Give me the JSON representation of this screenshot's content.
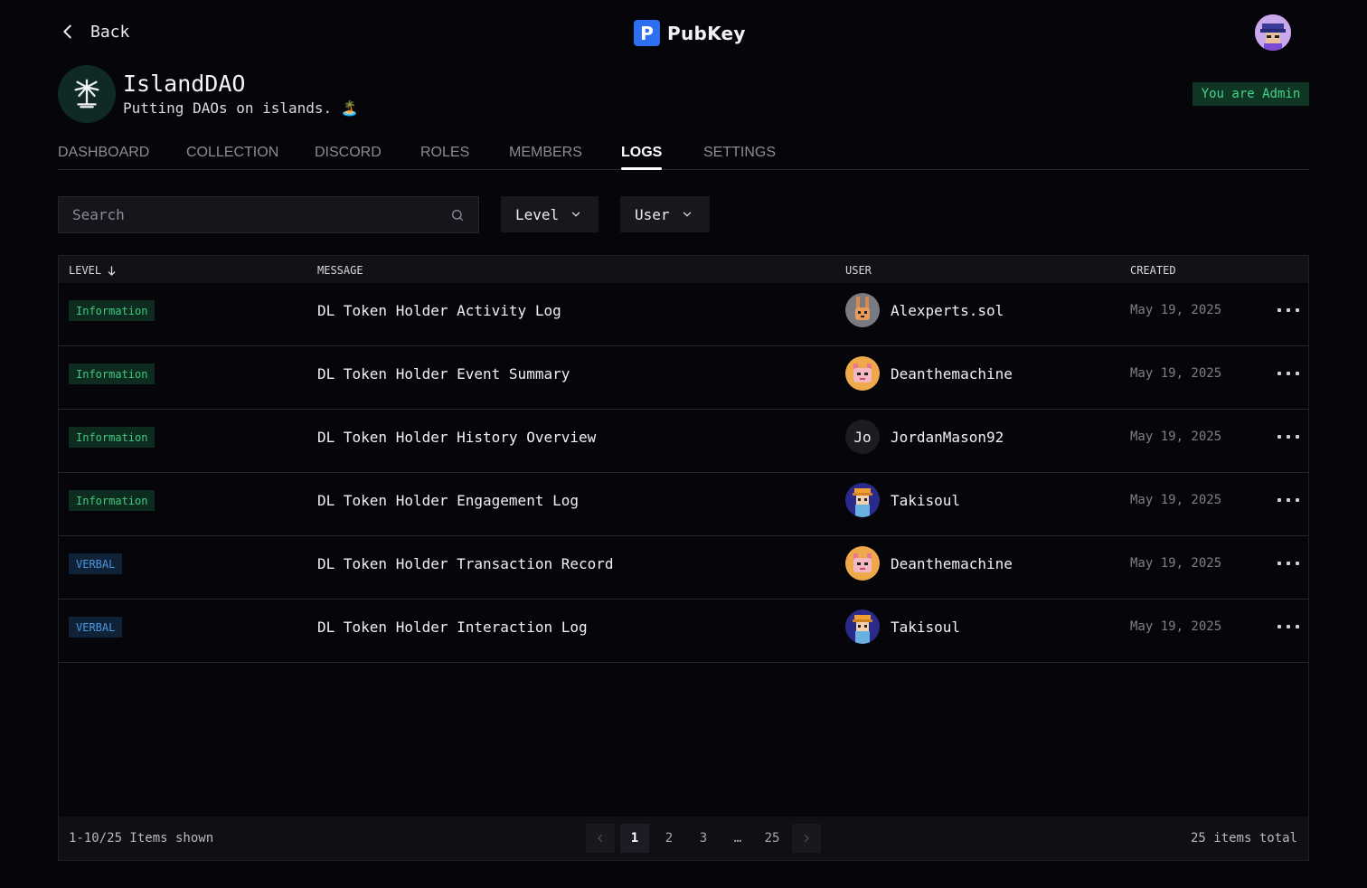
{
  "header": {
    "back_label": "Back",
    "brand_letter": "P",
    "brand_name": "PubKey"
  },
  "dao": {
    "name": "IslandDAO",
    "tagline": "Putting DAOs on islands. 🏝️",
    "admin_badge": "You are Admin"
  },
  "tabs": [
    {
      "label": "DASHBOARD"
    },
    {
      "label": "COLLECTION"
    },
    {
      "label": "DISCORD"
    },
    {
      "label": "ROLES"
    },
    {
      "label": "MEMBERS"
    },
    {
      "label": "LOGS"
    },
    {
      "label": "SETTINGS"
    }
  ],
  "active_tab": "LOGS",
  "filters": {
    "search_placeholder": "Search",
    "level_label": "Level",
    "user_label": "User"
  },
  "table": {
    "headers": {
      "level": "LEVEL",
      "message": "MESSAGE",
      "user": "USER",
      "created": "CREATED"
    },
    "rows": [
      {
        "level": "Information",
        "message": "DL Token Holder Activity Log",
        "user": "Alexperts.sol",
        "avatar": "rabbit-avatar",
        "created": "May 19, 2025"
      },
      {
        "level": "Information",
        "message": "DL Token Holder Event Summary",
        "user": "Deanthemachine",
        "avatar": "fox-avatar",
        "created": "May 19, 2025"
      },
      {
        "level": "Information",
        "message": "DL Token Holder History Overview",
        "user": "JordanMason92",
        "avatar": "initials-avatar",
        "initials": "Jo",
        "created": "May 19, 2025"
      },
      {
        "level": "Information",
        "message": "DL Token Holder Engagement Log",
        "user": "Takisoul",
        "avatar": "pixel-avatar",
        "created": "May 19, 2025"
      },
      {
        "level": "VERBAL",
        "message": "DL Token Holder Transaction Record",
        "user": "Deanthemachine",
        "avatar": "fox-avatar",
        "created": "May 19, 2025"
      },
      {
        "level": "VERBAL",
        "message": "DL Token Holder Interaction Log",
        "user": "Takisoul",
        "avatar": "pixel-avatar",
        "created": "May 19, 2025"
      }
    ]
  },
  "pagination": {
    "shown_label": "1-10/25 Items shown",
    "total_label": "25 items total",
    "pages": [
      "1",
      "2",
      "3",
      "…",
      "25"
    ],
    "current_page": "1"
  },
  "colors": {
    "accent": "#2d6ff0",
    "info_badge_text": "#40c97f",
    "verbal_badge_text": "#4d97e0",
    "admin_badge_text": "#43d48a"
  },
  "icons": {
    "back": "chevron-left-icon",
    "search": "search-icon",
    "dropdown": "chevron-down-icon",
    "sort": "arrow-down-icon",
    "row_menu": "more-horizontal-icon",
    "dao_logo": "palm-tree-icon"
  }
}
